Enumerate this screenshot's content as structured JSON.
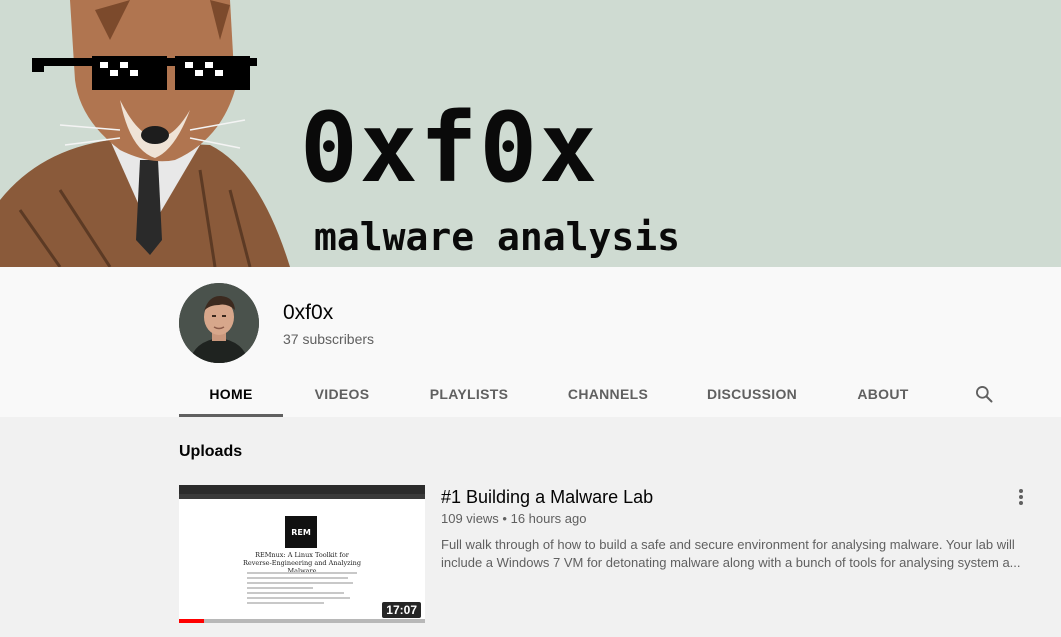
{
  "banner": {
    "title": "0xf0x",
    "subtitle": "malware analysis"
  },
  "channel": {
    "name": "0xf0x",
    "subscribers": "37 subscribers"
  },
  "tabs": [
    {
      "label": "HOME",
      "active": true
    },
    {
      "label": "VIDEOS"
    },
    {
      "label": "PLAYLISTS"
    },
    {
      "label": "CHANNELS"
    },
    {
      "label": "DISCUSSION"
    },
    {
      "label": "ABOUT"
    }
  ],
  "icons": {
    "search": "search-icon",
    "more": "more-vert-icon"
  },
  "uploads": {
    "section_title": "Uploads",
    "videos": [
      {
        "title": "#1 Building a Malware Lab",
        "meta": "109 views • 16 hours ago",
        "description": "Full walk through of how to build a safe and secure environment for analysing malware. Your lab will include a Windows 7 VM for detonating malware along with a bunch of tools for analysing system a...",
        "duration": "17:07",
        "watched_fraction": 0.1,
        "thumbnail": {
          "logo_text": "REM",
          "heading": "REMnux: A Linux Toolkit for Reverse-Engineering and Analyzing Malware"
        }
      }
    ]
  },
  "colors": {
    "banner_bg": "#cfdbd2",
    "progress": "#ff0000",
    "text_secondary": "#606060"
  }
}
